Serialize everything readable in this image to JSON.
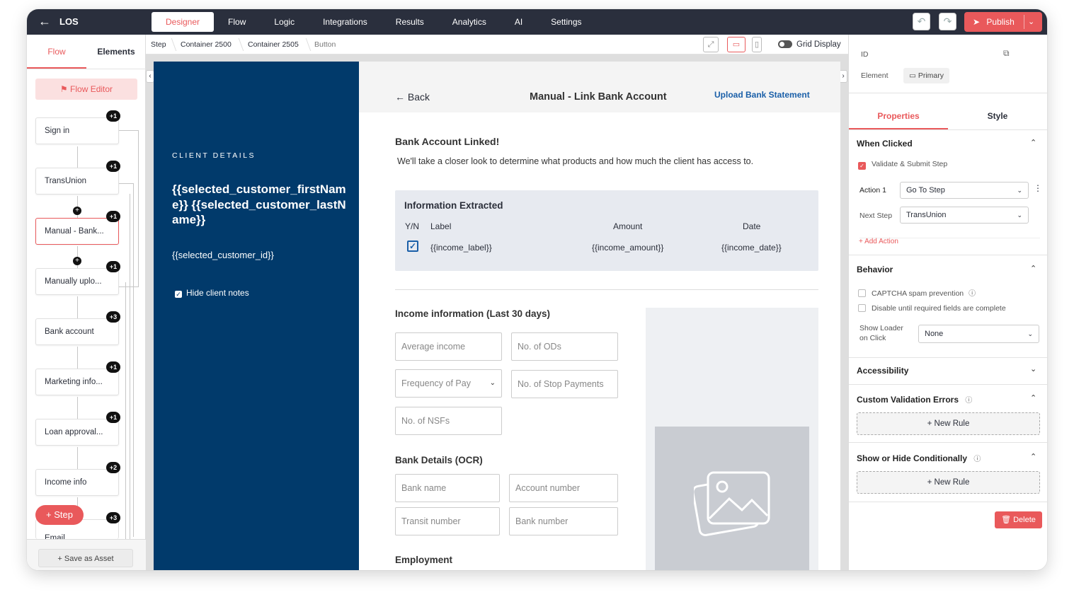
{
  "app": {
    "title": "LOS",
    "publish": "Publish"
  },
  "nav": [
    "Designer",
    "Flow",
    "Logic",
    "Integrations",
    "Results",
    "Analytics",
    "AI",
    "Settings"
  ],
  "left": {
    "tabs": [
      "Flow",
      "Elements"
    ],
    "flow_editor": "Flow Editor",
    "nodes": [
      {
        "label": "Sign in",
        "badge": "+1"
      },
      {
        "label": "TransUnion",
        "badge": "+1"
      },
      {
        "label": "Manual - Bank...",
        "badge": "+1"
      },
      {
        "label": "Manually uplo...",
        "badge": "+1"
      },
      {
        "label": "Bank account",
        "badge": "+3"
      },
      {
        "label": "Marketing info...",
        "badge": "+1"
      },
      {
        "label": "Loan approval...",
        "badge": "+1"
      },
      {
        "label": "Income info",
        "badge": "+2"
      },
      {
        "label": "Email",
        "badge": "+3"
      }
    ],
    "step_button": "+ Step",
    "save_asset": "Save as Asset"
  },
  "breadcrumb": [
    "Step",
    "Container 2500",
    "Container 2505",
    "Button"
  ],
  "grid_display": "Grid Display",
  "client": {
    "heading": "CLIENT DETAILS",
    "name": "{{selected_customer_firstName}} {{selected_customer_lastName}}",
    "id": "{{selected_customer_id}}",
    "hide_notes": "Hide client notes"
  },
  "form": {
    "back": "Back",
    "title": "Manual - Link Bank Account",
    "upload": "Upload Bank Statement",
    "linked_heading": "Bank Account Linked!",
    "linked_text": "We'll take a closer look to determine what products and  how much the client has access to.",
    "info": {
      "heading": "Information Extracted",
      "cols": [
        "Y/N",
        "Label",
        "Amount",
        "Date"
      ],
      "row": [
        "{{income_label}}",
        "{{income_amount}}",
        "{{income_date}}"
      ]
    },
    "income_heading": "Income information (Last 30 days)",
    "income_fields": [
      "Average income",
      "No. of ODs",
      "Frequency of Pay",
      "No. of Stop Payments",
      "No. of NSFs"
    ],
    "bank_heading": "Bank Details (OCR)",
    "bank_fields": [
      "Bank name",
      "Account number",
      "Transit number",
      "Bank number"
    ],
    "employment_heading": "Employment"
  },
  "right": {
    "id_label": "ID",
    "element_label": "Element",
    "element_value": "Primary",
    "tabs": [
      "Properties",
      "Style"
    ],
    "when_clicked": {
      "title": "When Clicked",
      "validate": "Validate & Submit Step",
      "action_label": "Action 1",
      "action_value": "Go To Step",
      "next_label": "Next Step",
      "next_value": "TransUnion",
      "add_action": "+ Add Action"
    },
    "behavior": {
      "title": "Behavior",
      "captcha": "CAPTCHA spam prevention",
      "disable": "Disable until required fields are complete",
      "loader_label": "Show Loader on Click",
      "loader_value": "None"
    },
    "accessibility": "Accessibility",
    "validation": "Custom Validation Errors",
    "new_rule": "+ New Rule",
    "conditional": "Show or Hide Conditionally",
    "delete": "Delete"
  },
  "colors": {
    "accent": "#e9595b",
    "topbar": "#2a2f3d",
    "client_panel": "#013a6b",
    "link": "#1a5fa8"
  }
}
